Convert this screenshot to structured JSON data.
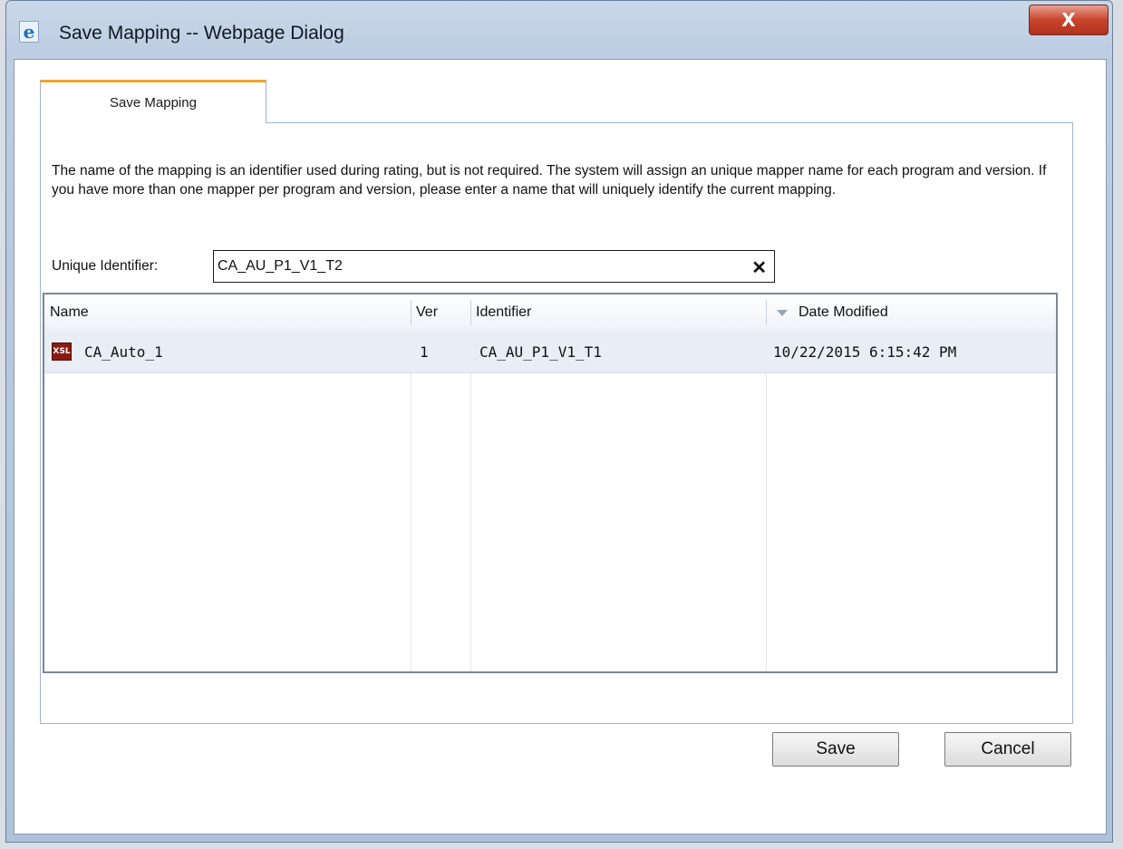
{
  "window": {
    "title": "Save Mapping -- Webpage Dialog",
    "close_label": "X"
  },
  "tab": {
    "label": "Save Mapping"
  },
  "description": "The name of the mapping is an identifier used during rating, but is not required. The system will assign an unique mapper name for each program and version. If you have more than one mapper per program and version, please enter a name that will uniquely identify the current mapping.",
  "identifier_field": {
    "label": "Unique Identifier:",
    "value": "CA_AU_P1_V1_T2",
    "clear_label": "✕"
  },
  "grid": {
    "columns": [
      "Name",
      "Ver",
      "Identifier",
      "Date Modified"
    ],
    "sort_column": "Date Modified",
    "rows": [
      {
        "icon": "xsl-file-icon",
        "icon_text": "XSL",
        "name": "CA_Auto_1",
        "ver": "1",
        "identifier": "CA_AU_P1_V1_T1",
        "date_modified": "10/22/2015 6:15:42 PM"
      }
    ]
  },
  "buttons": {
    "save": "Save",
    "cancel": "Cancel"
  },
  "colors": {
    "tab_accent": "#f1a531",
    "close_button": "#c8442c",
    "selected_row": "#e9eef6"
  }
}
